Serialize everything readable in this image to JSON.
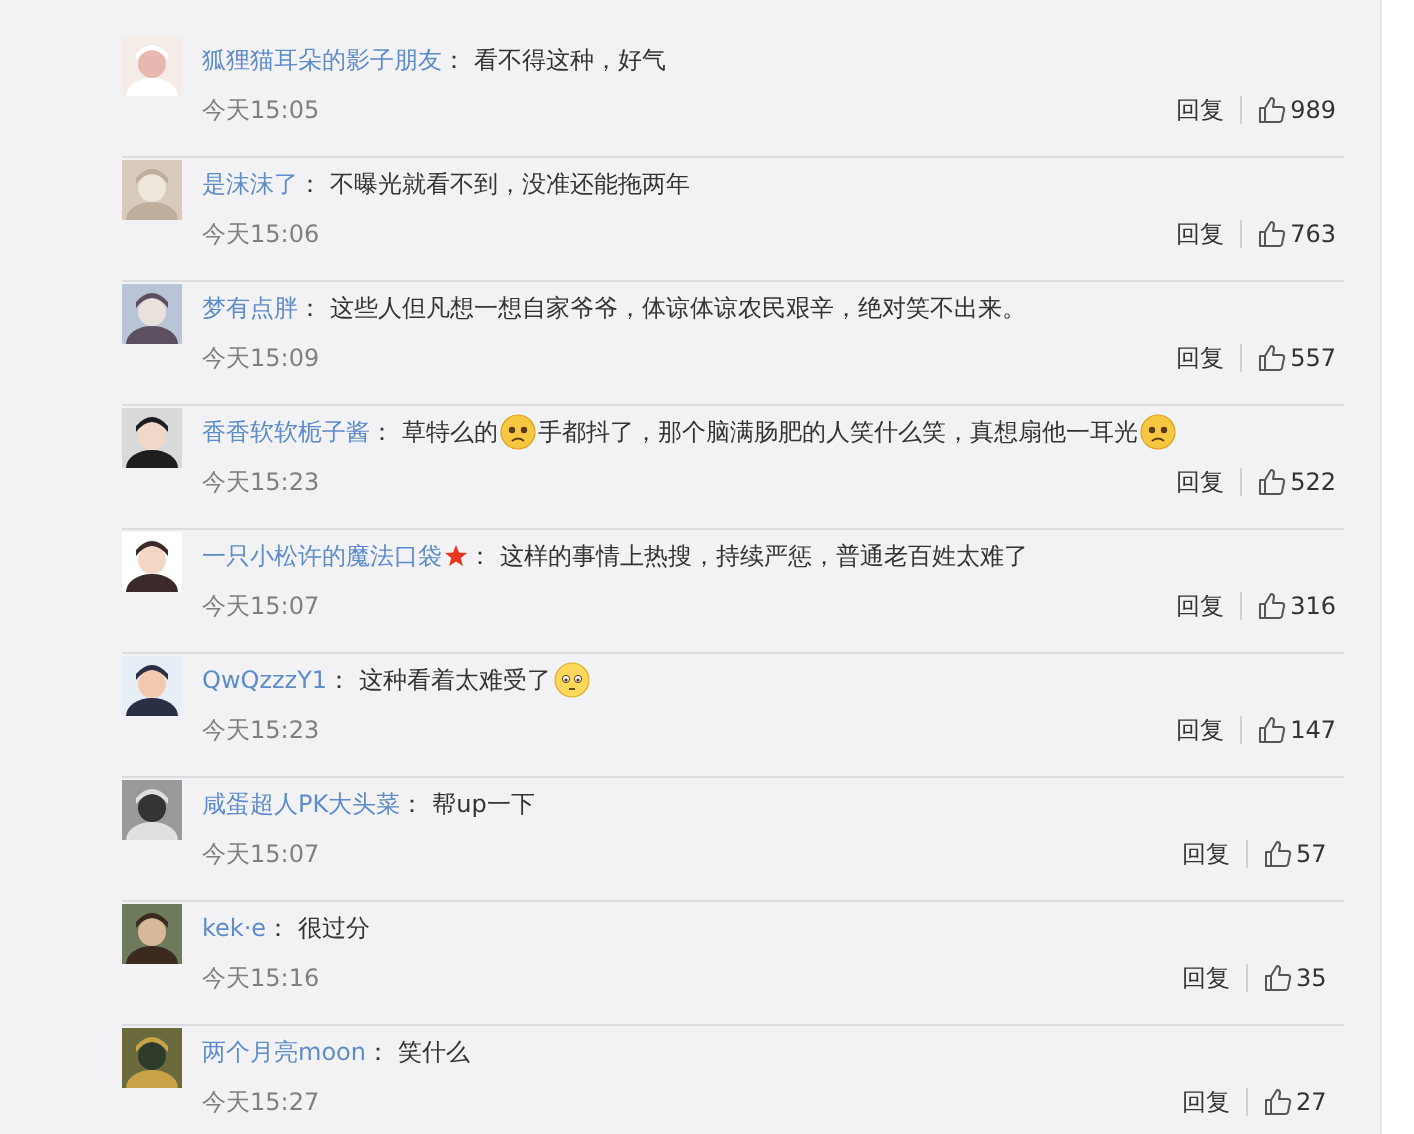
{
  "comments": [
    {
      "user": "狐狸猫耳朵的影子朋友",
      "badge": false,
      "content": [
        {
          "kind": "text",
          "text": "看不得这种，好气"
        }
      ],
      "time": "今天15:05",
      "reply": "回复",
      "likes": "989"
    },
    {
      "user": "是沫沫了",
      "badge": false,
      "content": [
        {
          "kind": "text",
          "text": "不曝光就看不到，没准还能拖两年"
        }
      ],
      "time": "今天15:06",
      "reply": "回复",
      "likes": "763"
    },
    {
      "user": "梦有点胖",
      "badge": false,
      "content": [
        {
          "kind": "text",
          "text": "这些人但凡想一想自家爷爷，体谅体谅农民艰辛，绝对笑不出来。"
        }
      ],
      "time": "今天15:09",
      "reply": "回复",
      "likes": "557"
    },
    {
      "user": "香香软软栀子酱",
      "badge": false,
      "content": [
        {
          "kind": "text",
          "text": "草特么的"
        },
        {
          "kind": "sad-emoji"
        },
        {
          "kind": "text",
          "text": "手都抖了，那个脑满肠肥的人笑什么笑，真想扇他一耳光"
        },
        {
          "kind": "sad-emoji"
        }
      ],
      "time": "今天15:23",
      "reply": "回复",
      "likes": "522"
    },
    {
      "user": "一只小松许的魔法口袋",
      "badge": true,
      "content": [
        {
          "kind": "text",
          "text": "这样的事情上热搜，持续严惩，普通老百姓太难了"
        }
      ],
      "time": "今天15:07",
      "reply": "回复",
      "likes": "316"
    },
    {
      "user": "QwQzzzY1",
      "badge": false,
      "content": [
        {
          "kind": "text",
          "text": "这种看着太难受了"
        },
        {
          "kind": "blush-emoji"
        }
      ],
      "time": "今天15:23",
      "reply": "回复",
      "likes": "147"
    },
    {
      "user": "咸蛋超人PK大头菜",
      "badge": false,
      "content": [
        {
          "kind": "text",
          "text": "帮up一下"
        }
      ],
      "time": "今天15:07",
      "reply": "回复",
      "likes": "57"
    },
    {
      "user": "kek·e",
      "badge": false,
      "content": [
        {
          "kind": "text",
          "text": "很过分"
        }
      ],
      "time": "今天15:16",
      "reply": "回复",
      "likes": "35"
    },
    {
      "user": "两个月亮moon",
      "badge": false,
      "content": [
        {
          "kind": "text",
          "text": "笑什么"
        }
      ],
      "time": "今天15:27",
      "reply": "回复",
      "likes": "27"
    }
  ],
  "colon": "："
}
